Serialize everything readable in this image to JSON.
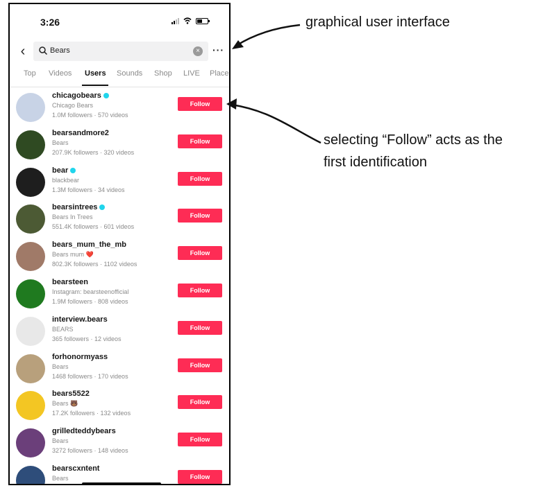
{
  "status_bar": {
    "time": "3:26"
  },
  "search": {
    "back_icon": "chevron-left-icon",
    "query": "Bears",
    "more_label": "···"
  },
  "tabs": [
    {
      "label": "Top",
      "active": false
    },
    {
      "label": "Videos",
      "active": false
    },
    {
      "label": "Users",
      "active": true
    },
    {
      "label": "Sounds",
      "active": false
    },
    {
      "label": "Shop",
      "active": false
    },
    {
      "label": "LIVE",
      "active": false
    },
    {
      "label": "Places",
      "active": false
    }
  ],
  "follow_label": "Follow",
  "users": [
    {
      "username": "chicagobears",
      "verified": true,
      "subtitle": "Chicago Bears",
      "meta": "1.0M followers · 570 videos",
      "avatar_color": "#c8d3e6"
    },
    {
      "username": "bearsandmore2",
      "verified": false,
      "subtitle": "Bears",
      "meta": "207.9K followers · 320 videos",
      "avatar_color": "#2f4a22"
    },
    {
      "username": "bear",
      "verified": true,
      "subtitle": "blackbear",
      "meta": "1.3M followers · 34 videos",
      "avatar_color": "#1e1e1e"
    },
    {
      "username": "bearsintrees",
      "verified": true,
      "subtitle": "Bears In Trees",
      "meta": "551.4K followers · 601 videos",
      "avatar_color": "#4c5a34"
    },
    {
      "username": "bears_mum_the_mb",
      "verified": false,
      "subtitle": "Bears mum ❤️",
      "meta": "802.3K followers · 1102 videos",
      "avatar_color": "#a07a68"
    },
    {
      "username": "bearsteen",
      "verified": false,
      "subtitle": "Instagram: bearsteenofficial",
      "meta": "1.9M followers · 808 videos",
      "avatar_color": "#1f7a1f"
    },
    {
      "username": "interview.bears",
      "verified": false,
      "subtitle": "BEARS",
      "meta": "365 followers · 12 videos",
      "avatar_color": "#e8e8e8"
    },
    {
      "username": "forhonormyass",
      "verified": false,
      "subtitle": "Bears",
      "meta": "1468 followers · 170 videos",
      "avatar_color": "#b8a07c"
    },
    {
      "username": "bears5522",
      "verified": false,
      "subtitle": "Bears 🐻",
      "meta": "17.2K followers · 132 videos",
      "avatar_color": "#f3c623"
    },
    {
      "username": "grilledteddybears",
      "verified": false,
      "subtitle": "Bears",
      "meta": "3272 followers · 148 videos",
      "avatar_color": "#6b3f7a"
    },
    {
      "username": "bearscxntent",
      "verified": false,
      "subtitle": "Bears",
      "meta": "",
      "avatar_color": "#2e4d7a"
    }
  ],
  "annotations": {
    "gui_label": "graphical user interface",
    "follow_line1": "selecting “Follow” acts as the",
    "follow_line2": "first identification"
  },
  "colors": {
    "follow_button": "#fe2c55",
    "verified_badge": "#20d5ec"
  }
}
